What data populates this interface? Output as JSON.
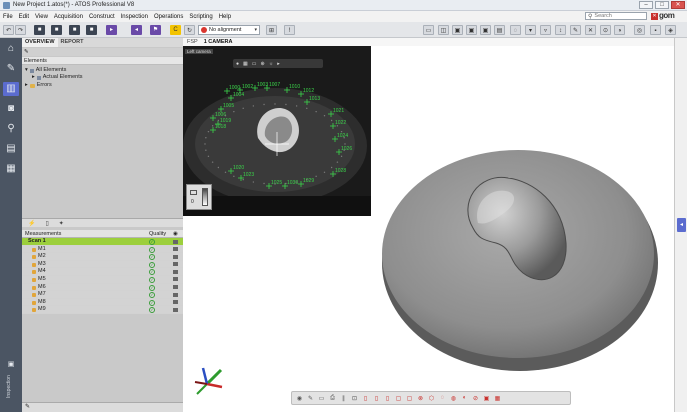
{
  "window": {
    "title": "New Project 1.atos(*) - ATOS Professional V8",
    "buttons": {
      "minimize": "–",
      "maximize": "□",
      "close": "✕"
    }
  },
  "menu": {
    "items": [
      "File",
      "Edit",
      "View",
      "Acquisition",
      "Construct",
      "Inspection",
      "Operations",
      "Scripting",
      "Help"
    ],
    "search_placeholder": "Search",
    "logo": "gom"
  },
  "toolbar": {
    "alignment_value": "No alignment"
  },
  "leftbar": {
    "icons": [
      "home-icon",
      "tools-icon",
      "grid-icon",
      "camera-icon",
      "search-icon",
      "document-icon",
      "table-icon"
    ],
    "vertical_label": "Inspection"
  },
  "explorer": {
    "tabs": [
      "OVERVIEW",
      "REPORT"
    ],
    "elements_header": "Elements",
    "tree": {
      "all_elements": "All Elements",
      "actual_elements": "Actual Elements",
      "errors": "Errors"
    },
    "measurements": {
      "col_name": "Measurements",
      "col_quality": "Quality",
      "scan": "Scan 1",
      "items": [
        "M1",
        "M2",
        "M3",
        "M4",
        "M5",
        "M6",
        "M7",
        "M8",
        "M9"
      ]
    }
  },
  "viewport": {
    "tabs": [
      "FSP",
      "1 CAMERA"
    ],
    "camera_label": "Left camera",
    "legend_label": "0",
    "point_labels": [
      "1000",
      "1002",
      "1003",
      "1004",
      "1005",
      "1006",
      "1007",
      "1010",
      "1012",
      "1013",
      "1018",
      "1019",
      "1020",
      "1021",
      "1022",
      "1023",
      "1024",
      "1025",
      "1026",
      "1028",
      "1029",
      "1030"
    ]
  },
  "colors": {
    "accent": "#5b6ccf",
    "scan_row": "#9ccf3c",
    "marker": "#3bd44b",
    "leftbar": "#4b5563"
  }
}
